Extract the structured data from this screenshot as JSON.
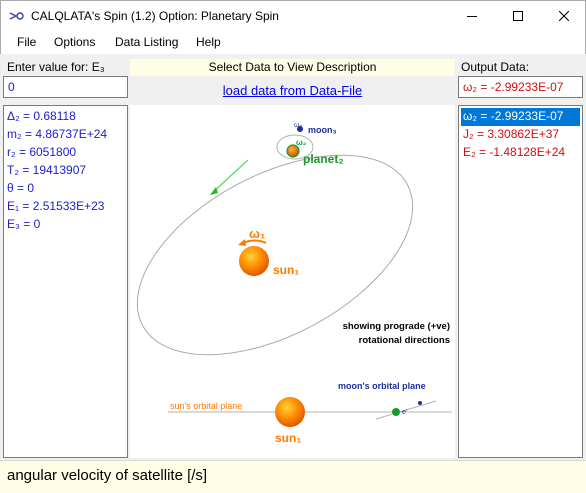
{
  "window": {
    "title": "CALQLATA's  Spin (1.2)  Option: Planetary Spin"
  },
  "menu": [
    "File",
    "Options",
    "Data Listing",
    "Help"
  ],
  "input": {
    "label": "Enter value for: E₃",
    "value": "0"
  },
  "output": {
    "label": "Output Data:",
    "value": "ω₂ = -2.99233E-07"
  },
  "center": {
    "hint": "Select Data to View Description",
    "load_link": "load data from Data-File"
  },
  "inputs_list": [
    "Δ₂ = 0.68118",
    "m₂ = 4.86737E+24",
    "r₂ = 6051800",
    "T₂ = 19413907",
    "θ = 0",
    "E₁ = 2.51533E+23",
    "E₃ = 0"
  ],
  "outputs_list": [
    "ω₂ = -2.99233E-07",
    "J₂ = 3.30862E+37",
    "E₂ = -1.48128E+24"
  ],
  "diagram": {
    "moon_label": "moon₃",
    "omega3": "ω₃",
    "omega2": "ω₂",
    "planet_label": "planet₂",
    "omega1": "ω₁",
    "sun_label": "sun₁",
    "note_line1": "showing prograde (+ve)",
    "note_line2": "rotational directions",
    "moon_orbital_plane": "moon's orbital plane",
    "sun_orbital_plane": "sun's orbital plane",
    "sun_label_2": "sun₁",
    "e_label": "e'"
  },
  "status": {
    "text": "angular velocity of satellite [/s]"
  },
  "colors": {
    "input_text": "#1c1ccc",
    "output_text": "#d01010",
    "selection": "#0078d7",
    "sun": "#ff8c00",
    "planet": "#1a9a2a",
    "moon": "#1c2fa0",
    "orbit": "#aaaaaa"
  }
}
